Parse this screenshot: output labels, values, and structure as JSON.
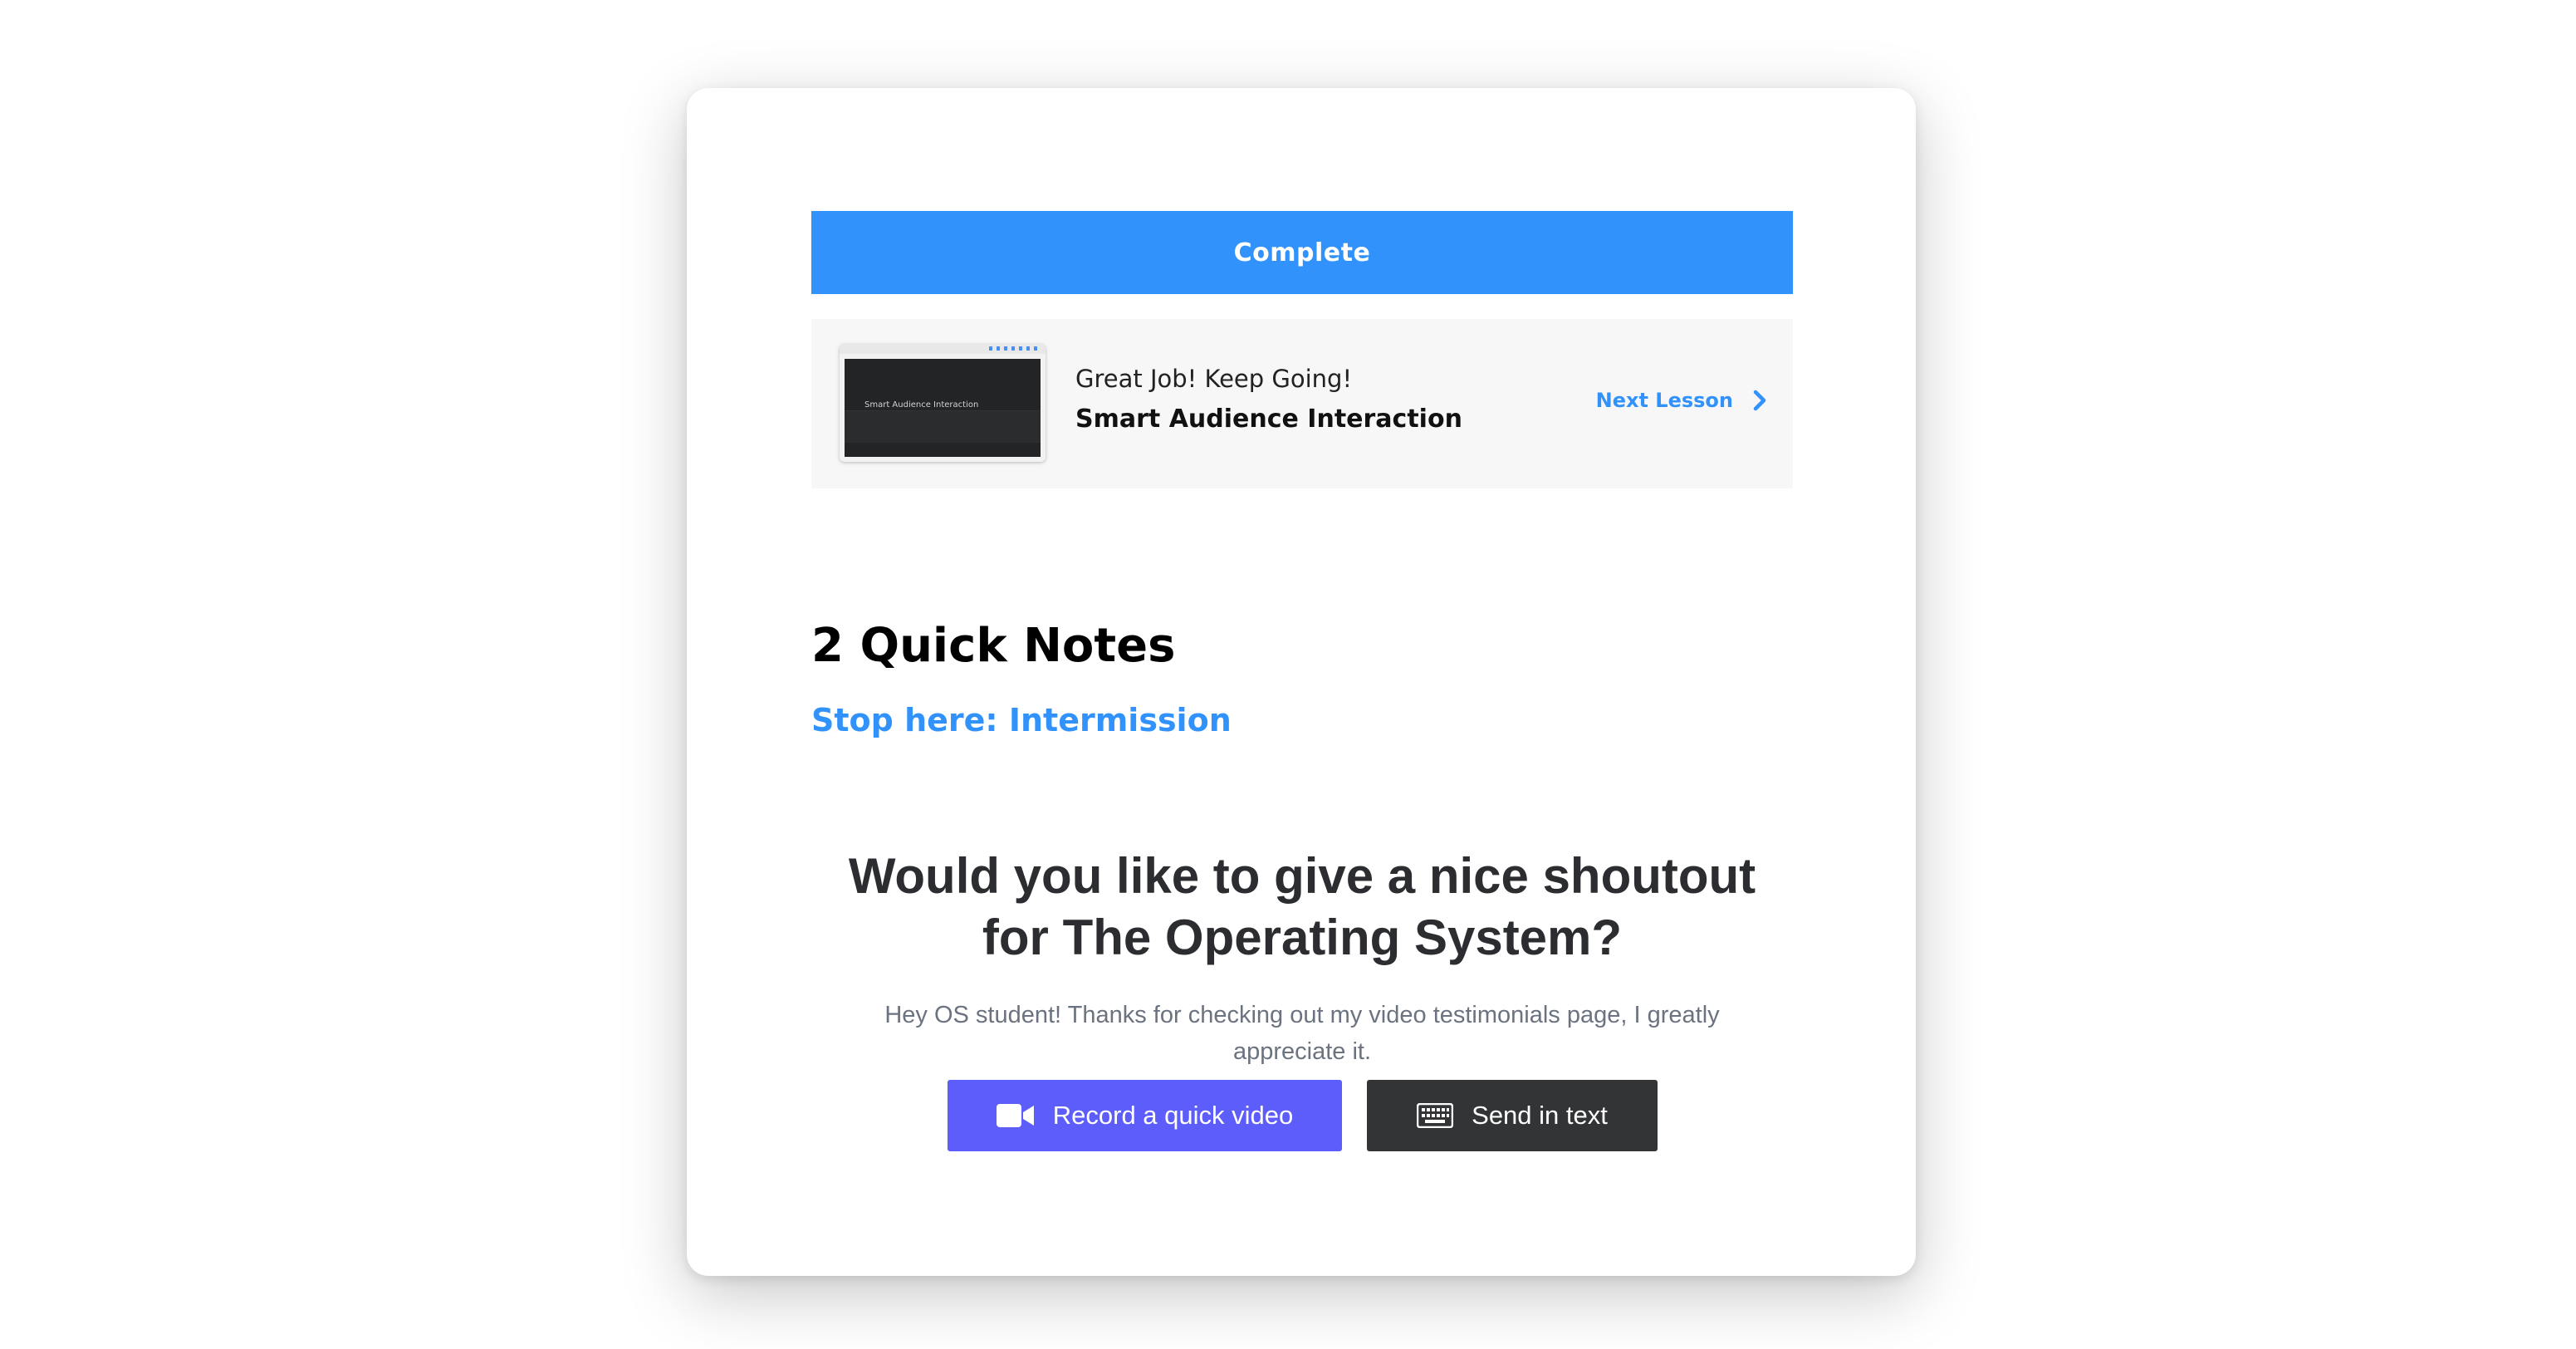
{
  "complete_button": {
    "label": "Complete"
  },
  "next_panel": {
    "thumbnail_caption": "Smart Audience Interaction",
    "subtitle": "Great Job! Keep Going!",
    "lesson_title": "Smart Audience Interaction",
    "next_label": "Next Lesson"
  },
  "notes": {
    "heading": "2 Quick Notes",
    "link": "Stop here: Intermission"
  },
  "testimonial": {
    "title": "Would you like to give a nice shoutout for The Operating System?",
    "description": "Hey OS student! Thanks for checking out my video testimonials page, I greatly appreciate it.",
    "video_button": "Record a quick video",
    "text_button": "Send in text"
  },
  "colors": {
    "accent_blue": "#3192fb",
    "video_button": "#5d5dfb",
    "text_button": "#333436"
  },
  "icons": {
    "video": "video-camera-icon",
    "text": "keyboard-icon",
    "next": "chevron-right-icon"
  }
}
